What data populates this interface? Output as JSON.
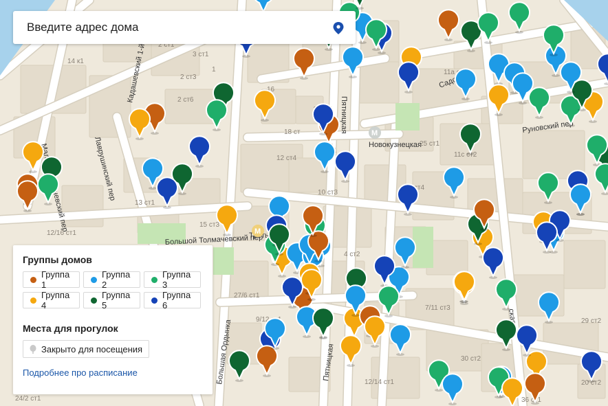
{
  "search": {
    "placeholder": "Введите адрес дома",
    "pin_icon": "map-pin-icon"
  },
  "colors": {
    "group1": "#c55f12",
    "group2": "#1e9be6",
    "group3": "#1fae6a",
    "group4": "#f5a80f",
    "group5": "#0f6631",
    "group6": "#1543b7",
    "closed": "#c9c9c9",
    "link": "#1a56a8"
  },
  "legend": {
    "groups_title": "Группы домов",
    "groups": [
      {
        "label": "Группа 1",
        "color": "#c55f12"
      },
      {
        "label": "Группа 2",
        "color": "#1e9be6"
      },
      {
        "label": "Группа 3",
        "color": "#1fae6a"
      },
      {
        "label": "Группа 4",
        "color": "#f5a80f"
      },
      {
        "label": "Группа 5",
        "color": "#0f6631"
      },
      {
        "label": "Группа 6",
        "color": "#1543b7"
      }
    ],
    "walks_title": "Места для прогулок",
    "walks": [
      {
        "label": "Закрыто для посещения",
        "icon": "tree-icon"
      }
    ],
    "more_link": "Подробнее про расписание"
  },
  "map": {
    "streets": [
      "Кадашевский 1-й",
      "Лаврушинский пер",
      "Малый Толмачевский пер",
      "Большой Толмачевский пер",
      "Пятницкая",
      "Садовническая",
      "Руновский пер",
      "Новокузнецкая",
      "Большая Ордынка",
      "Третьяковская",
      "Лаврская"
    ],
    "street_labels": [
      {
        "text": "Кадашевский 1-й",
        "street": 0
      },
      {
        "text": "Лаврушинский пер",
        "street": 1
      },
      {
        "text": "Малый Толмачевский пер",
        "street": 2
      },
      {
        "text": "Большой Толмачевский пер",
        "street": 3
      },
      {
        "text": "Пятницкая",
        "street": 4
      },
      {
        "text": "Пятницкая",
        "street": 4
      },
      {
        "text": "Садовни",
        "street": 5
      },
      {
        "text": "Руновский пер",
        "street": 6
      },
      {
        "text": "Новокузнецкая",
        "street": 7
      },
      {
        "text": "Большая Ордынка",
        "street": 8
      },
      {
        "text": "Третьяко",
        "street": 9
      },
      {
        "text": "овский",
        "street": 4
      },
      {
        "text": "ская",
        "street": 10
      },
      {
        "text": "д",
        "street": 5
      }
    ],
    "house_labels": [
      "14 к1",
      "2 ст1",
      "3 ст1",
      "2 ст3",
      "1",
      "2 ст6",
      "12 ст4",
      "16 ст1",
      "11а ст2",
      "25 ст1",
      "25 ст4",
      "9 ст1",
      "16",
      "18 ст",
      "15 ст3",
      "10 ст3",
      "27/6 ст1",
      "9/12 ст1",
      "7/11 ст3",
      "12/14 ст1",
      "30 ст2",
      "11с ст2",
      "24/2 ст1",
      "36 ст1",
      "20 ст2",
      "12/16 ст1",
      "13 ст1",
      "29 ст2",
      "4 ст2"
    ],
    "metro": [
      {
        "name": "Новокузнецкая",
        "label": "Новокузнецкая"
      },
      {
        "name": "Третьяковская",
        "label": "Третьяко"
      }
    ],
    "markers": [
      {
        "group": 4
      },
      {
        "group": 2
      },
      {
        "group": 6
      },
      {
        "group": 1
      },
      {
        "group": 5
      },
      {
        "group": 3
      },
      {
        "group": 1
      },
      {
        "group": 5
      },
      {
        "group": 3
      },
      {
        "group": 6
      },
      {
        "group": 2
      },
      {
        "group": 2
      },
      {
        "group": 4
      },
      {
        "group": 1
      },
      {
        "group": 5
      },
      {
        "group": 2
      },
      {
        "group": 3
      },
      {
        "group": 4
      },
      {
        "group": 6
      },
      {
        "group": 2
      },
      {
        "group": 6
      },
      {
        "group": 6
      },
      {
        "group": 4
      },
      {
        "group": 2
      },
      {
        "group": 1
      },
      {
        "group": 5
      },
      {
        "group": 3
      },
      {
        "group": 6
      },
      {
        "group": 2
      },
      {
        "group": 6
      },
      {
        "group": 4
      },
      {
        "group": 2
      },
      {
        "group": 5
      },
      {
        "group": 6
      },
      {
        "group": 2
      },
      {
        "group": 2
      },
      {
        "group": 6
      },
      {
        "group": 5
      },
      {
        "group": 3
      },
      {
        "group": 4
      },
      {
        "group": 2
      },
      {
        "group": 1
      },
      {
        "group": 2
      },
      {
        "group": 5
      },
      {
        "group": 3
      },
      {
        "group": 4
      },
      {
        "group": 3
      },
      {
        "group": 5
      },
      {
        "group": 1
      },
      {
        "group": 6
      },
      {
        "group": 4
      },
      {
        "group": 3
      },
      {
        "group": 2
      },
      {
        "group": 6
      },
      {
        "group": 2
      },
      {
        "group": 4
      },
      {
        "group": 1
      },
      {
        "group": 5
      },
      {
        "group": 2
      },
      {
        "group": 4
      },
      {
        "group": 6
      },
      {
        "group": 2
      },
      {
        "group": 5
      },
      {
        "group": 4
      },
      {
        "group": 2
      },
      {
        "group": 3
      },
      {
        "group": 4
      },
      {
        "group": 5
      },
      {
        "group": 3
      },
      {
        "group": 2
      },
      {
        "group": 6
      },
      {
        "group": 2
      },
      {
        "group": 6
      },
      {
        "group": 2
      },
      {
        "group": 4
      },
      {
        "group": 3
      },
      {
        "group": 4
      },
      {
        "group": 6
      },
      {
        "group": 5
      },
      {
        "group": 3
      },
      {
        "group": 2
      },
      {
        "group": 3
      },
      {
        "group": 4
      },
      {
        "group": 5
      },
      {
        "group": 3
      },
      {
        "group": 2
      },
      {
        "group": 6
      },
      {
        "group": 3
      },
      {
        "group": 1
      },
      {
        "group": 3
      },
      {
        "group": 4
      },
      {
        "group": 6
      },
      {
        "group": 2
      },
      {
        "group": 2
      },
      {
        "group": 4
      },
      {
        "group": 5
      },
      {
        "group": 5
      },
      {
        "group": 1
      },
      {
        "group": 6
      },
      {
        "group": 2
      },
      {
        "group": 1
      },
      {
        "group": 2
      },
      {
        "group": 4
      },
      {
        "group": 6
      },
      {
        "group": 1
      },
      {
        "group": 2
      },
      {
        "group": 4
      },
      {
        "group": 1
      },
      {
        "group": 2
      },
      {
        "group": 3
      },
      {
        "group": 5
      },
      {
        "group": 6
      },
      {
        "group": 4
      },
      {
        "group": 3
      },
      {
        "group": 2
      },
      {
        "group": 1
      }
    ]
  }
}
